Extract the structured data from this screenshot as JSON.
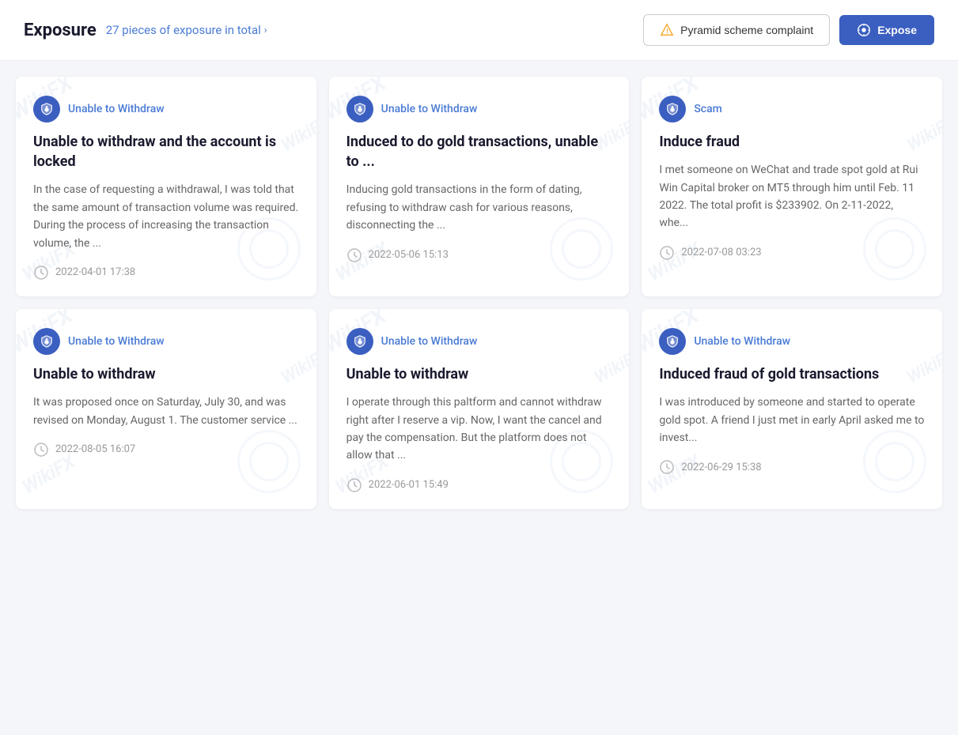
{
  "header": {
    "title": "Exposure",
    "count_label": "27 pieces of exposure in total",
    "pyramid_btn": "Pyramid scheme complaint",
    "expose_btn": "Expose"
  },
  "cards": [
    {
      "tag": "Unable to Withdraw",
      "title": "Unable to withdraw and the account is locked",
      "body": "In the case of requesting a withdrawal, I was told that the same amount of transaction volume was required. During the process of increasing the transaction volume, the ...",
      "date": "2022-04-01 17:38"
    },
    {
      "tag": "Unable to Withdraw",
      "title": "Induced to do gold transactions, unable to ...",
      "body": "Inducing gold transactions in the form of dating, refusing to withdraw cash for various reasons, disconnecting the ...",
      "date": "2022-05-06 15:13"
    },
    {
      "tag": "Scam",
      "title": "Induce fraud",
      "body": "I met someone on WeChat and trade spot gold at Rui Win Capital broker on MT5 through him until Feb. 11 2022. The total profit is $233902. On 2-11-2022, whe...",
      "date": "2022-07-08 03:23"
    },
    {
      "tag": "Unable to Withdraw",
      "title": "Unable to withdraw",
      "body": "It was proposed once on Saturday, July 30, and was revised on Monday, August 1. The customer service ...",
      "date": "2022-08-05 16:07"
    },
    {
      "tag": "Unable to Withdraw",
      "title": "Unable to withdraw",
      "body": "I operate through this paltform and cannot withdraw right after I reserve a vip. Now, I want the cancel and pay the compensation. But the platform does not allow that ...",
      "date": "2022-06-01 15:49"
    },
    {
      "tag": "Unable to Withdraw",
      "title": "Induced fraud of gold transactions",
      "body": "I was introduced by someone and started to operate gold spot. A friend I just met in early April asked me to invest...",
      "date": "2022-06-29 15:38"
    }
  ],
  "watermark": "WikiFX"
}
